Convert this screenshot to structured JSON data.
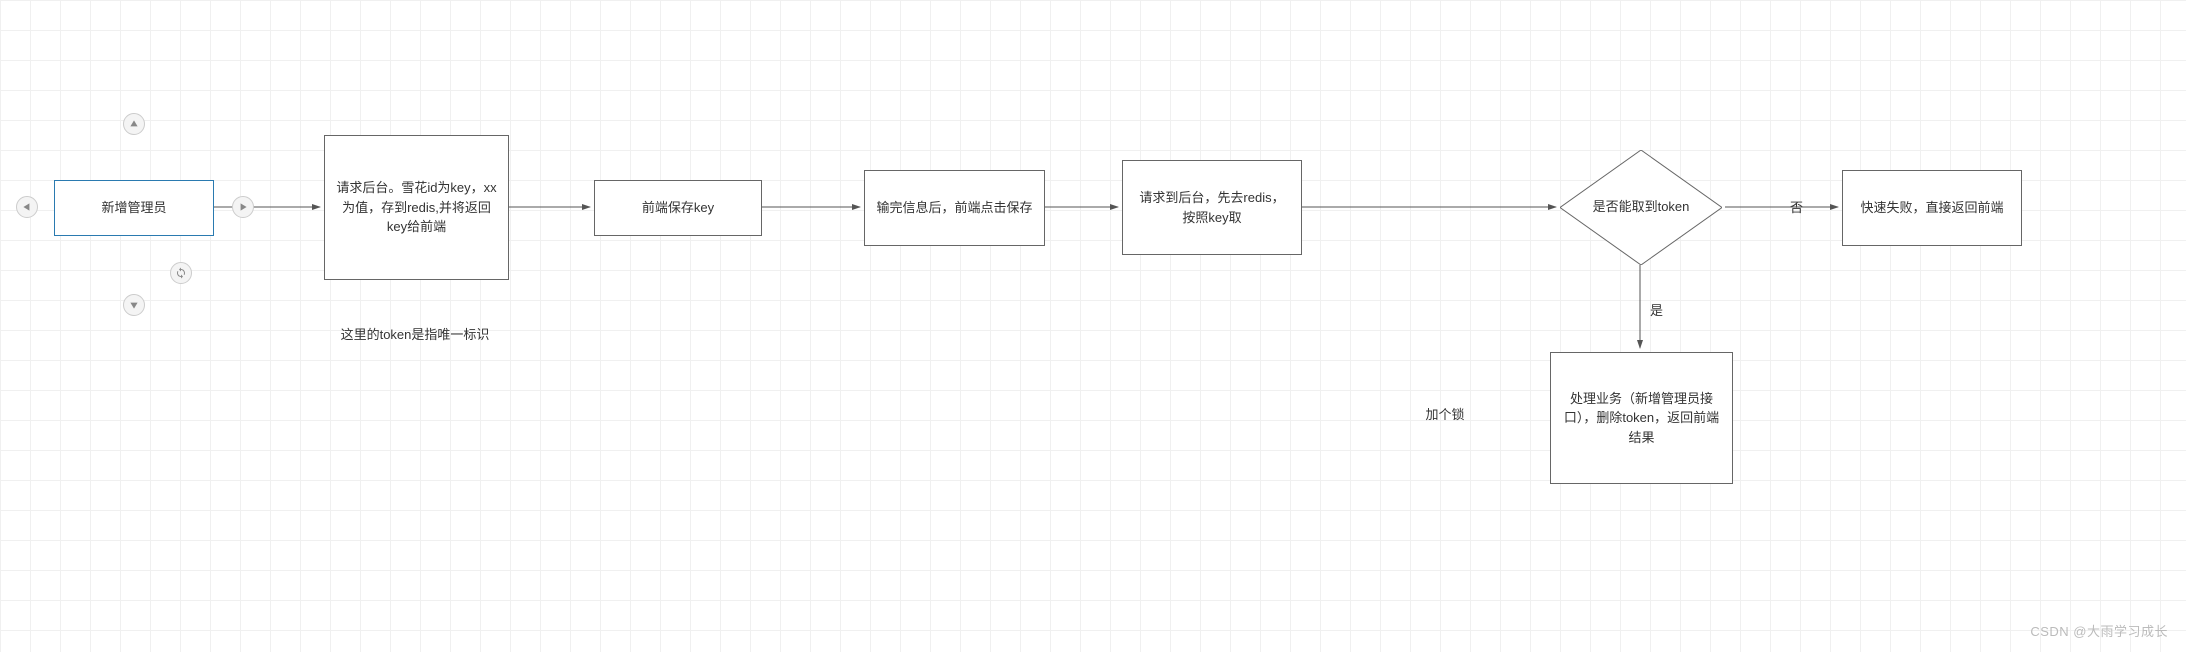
{
  "nodes": {
    "n1": "新增管理员",
    "n2": "请求后台。雪花id为key，xx为值，存到redis,并将返回key给前端",
    "n3": "前端保存key",
    "n4": "输完信息后，前端点击保存",
    "n5": "请求到后台，先去redis，按照key取",
    "decision": "是否能取到token",
    "n6": "快速失败，直接返回前端",
    "n7": "处理业务（新增管理员接口），删除token，返回前端结果"
  },
  "annotations": {
    "a1": "这里的token是指唯一标识",
    "a2": "加个锁"
  },
  "edge_labels": {
    "no": "否",
    "yes": "是"
  },
  "watermark": "CSDN @大雨学习成长",
  "colors": {
    "selected": "#2a7ab0",
    "stroke": "#555",
    "grid": "#f0f0f0"
  }
}
